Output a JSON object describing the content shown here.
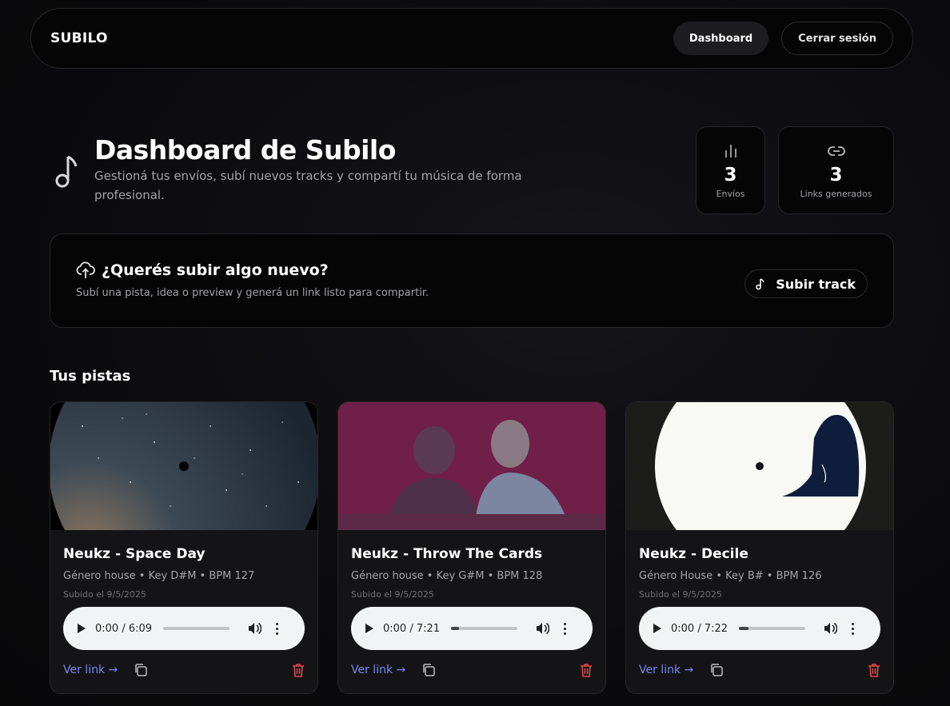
{
  "nav": {
    "brand": "SUBILO",
    "dashboard_label": "Dashboard",
    "logout_label": "Cerrar sesión"
  },
  "hero": {
    "icon": "music-note-icon",
    "title": "Dashboard de Subilo",
    "subtitle": "Gestioná tus envíos, subí nuevos tracks y compartí tu música de forma profesional."
  },
  "stats": [
    {
      "icon": "bar-chart-icon",
      "value": "3",
      "label": "Envíos"
    },
    {
      "icon": "link-icon",
      "value": "3",
      "label": "Links generados"
    }
  ],
  "upload": {
    "icon": "cloud-upload-icon",
    "title": "¿Querés subir algo nuevo?",
    "subtitle": "Subí una pista, idea o preview y generá un link listo para compartir.",
    "button_label": "Subir track"
  },
  "tracks_section": {
    "title": "Tus pistas"
  },
  "tracks": [
    {
      "title": "Neukz - Space Day",
      "meta": "Género house • Key D#M • BPM 127",
      "date": "Subido el 9/5/2025",
      "time": "0:00 / 6:09",
      "progress": 0.0,
      "link_label": "Ver link →"
    },
    {
      "title": "Neukz - Throw The Cards",
      "meta": "Género house • Key G#M • BPM 128",
      "date": "Subido el 9/5/2025",
      "time": "0:00 / 7:21",
      "progress": 0.12,
      "link_label": "Ver link →"
    },
    {
      "title": "Neukz - Decile",
      "meta": "Género House • Key B# • BPM 126",
      "date": "Subido el 9/5/2025",
      "time": "0:00 / 7:22",
      "progress": 0.15,
      "link_label": "Ver link →"
    }
  ],
  "colors": {
    "accent_link": "#7b85f5",
    "danger": "#e5484d",
    "background": "#0b0b0d"
  }
}
